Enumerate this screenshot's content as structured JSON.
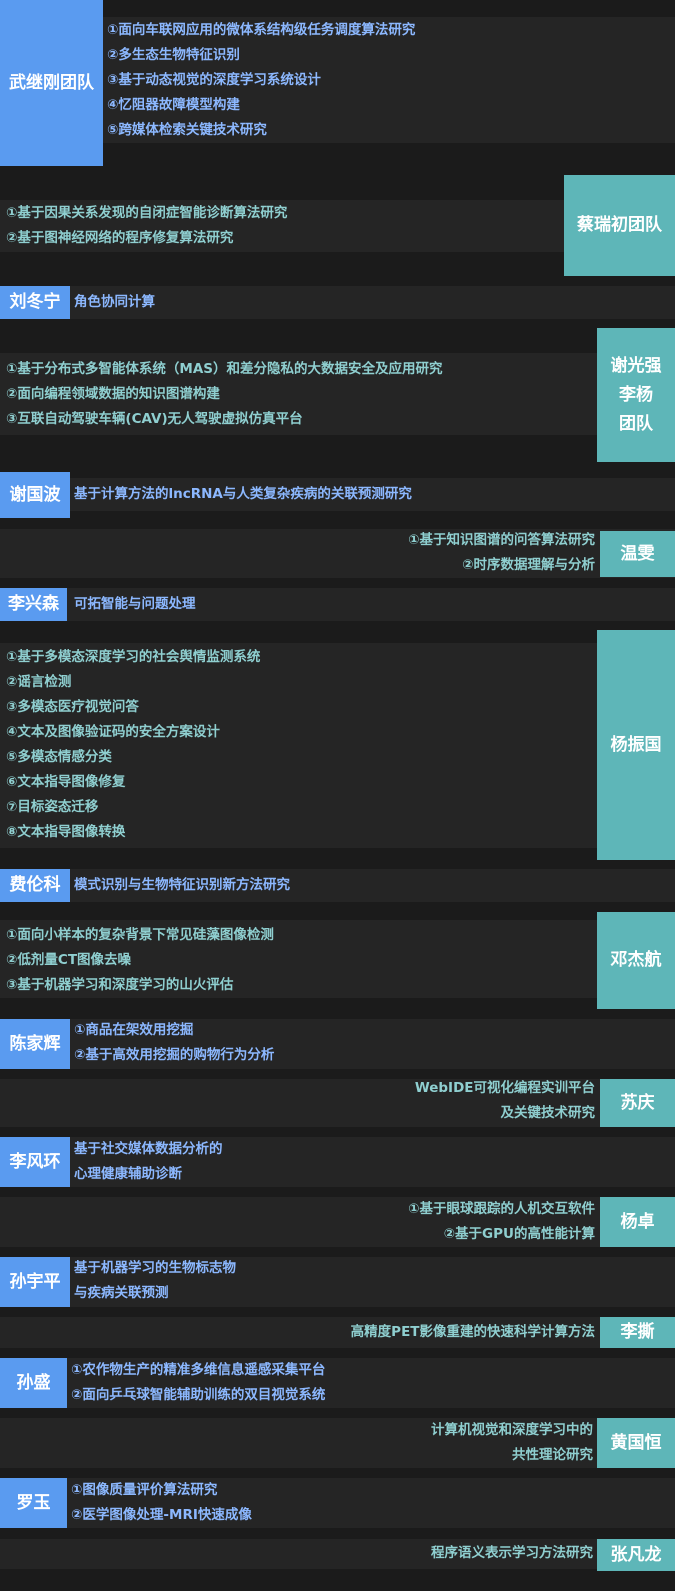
{
  "teams": [
    {
      "name": "武继刚团队",
      "projects": [
        "①面向车联网应用的微体系结构级任务调度算法研究",
        "②多生态生物特征识别",
        "③基于动态视觉的深度学习系统设计",
        "④忆阻器故障模型构建",
        "⑤跨媒体检索关键技术研究"
      ]
    },
    {
      "name": "蔡瑞初团队",
      "projects": [
        "①基于因果关系发现的自闭症智能诊断算法研究",
        "②基于图神经网络的程序修复算法研究"
      ]
    },
    {
      "name": "刘冬宁",
      "projects": [
        "角色协同计算"
      ]
    },
    {
      "name": "谢光强李杨团队",
      "name_lines": [
        "谢光强",
        "李杨",
        "团队"
      ],
      "projects": [
        "①基于分布式多智能体系统（MAS）和差分隐私的大数据安全及应用研究",
        "②面向编程领域数据的知识图谱构建",
        "③互联自动驾驶车辆(CAV)无人驾驶虚拟仿真平台"
      ]
    },
    {
      "name": "谢国波",
      "projects": [
        "基于计算方法的lncRNA与人类复杂疾病的关联预测研究"
      ]
    },
    {
      "name": "温雯",
      "projects": [
        "①基于知识图谱的问答算法研究",
        "②时序数据理解与分析"
      ]
    },
    {
      "name": "李兴森",
      "projects": [
        "可拓智能与问题处理"
      ]
    },
    {
      "name": "杨振国",
      "projects": [
        "①基于多模态深度学习的社会舆情监测系统",
        "②谣言检测",
        "③多模态医疗视觉问答",
        "④文本及图像验证码的安全方案设计",
        "⑤多模态情感分类",
        "⑥文本指导图像修复",
        "⑦目标姿态迁移",
        "⑧文本指导图像转换"
      ]
    },
    {
      "name": "费伦科",
      "projects": [
        "模式识别与生物特征识别新方法研究"
      ]
    },
    {
      "name": "邓杰航",
      "projects": [
        "①面向小样本的复杂背景下常见硅藻图像检测",
        "②低剂量CT图像去噪",
        "③基于机器学习和深度学习的山火评估"
      ]
    },
    {
      "name": "陈家辉",
      "projects": [
        "①商品在架效用挖掘",
        "②基于高效用挖掘的购物行为分析"
      ]
    },
    {
      "name": "苏庆",
      "projects": [
        "WebIDE可视化编程实训平台",
        "及关键技术研究"
      ]
    },
    {
      "name": "李风环",
      "projects": [
        "基于社交媒体数据分析的",
        "心理健康辅助诊断"
      ]
    },
    {
      "name": "杨卓",
      "projects": [
        "①基于眼球跟踪的人机交互软件",
        "②基于GPU的高性能计算"
      ]
    },
    {
      "name": "孙宇平",
      "projects": [
        "基于机器学习的生物标志物",
        "与疾病关联预测"
      ]
    },
    {
      "name": "李撕",
      "projects": [
        "高精度PET影像重建的快速科学计算方法"
      ]
    },
    {
      "name": "孙盛",
      "projects": [
        "①农作物生产的精准多维信息遥感采集平台",
        "②面向乒乓球智能辅助训练的双目视觉系统"
      ]
    },
    {
      "name": "黄国恒",
      "projects": [
        "计算机视觉和深度学习中的",
        "共性理论研究"
      ]
    },
    {
      "name": "罗玉",
      "projects": [
        "①图像质量评价算法研究",
        "②医学图像处理-MRI快速成像"
      ]
    },
    {
      "name": "张凡龙",
      "projects": [
        "程序语义表示学习方法研究"
      ]
    }
  ],
  "colors": {
    "blue_tag": "#5a9bf0",
    "teal_tag": "#5eb6b8",
    "blue_text": "#8cb8ff",
    "teal_text": "#8fcfd0",
    "band": "#252525",
    "background": "#1b1b1b"
  }
}
